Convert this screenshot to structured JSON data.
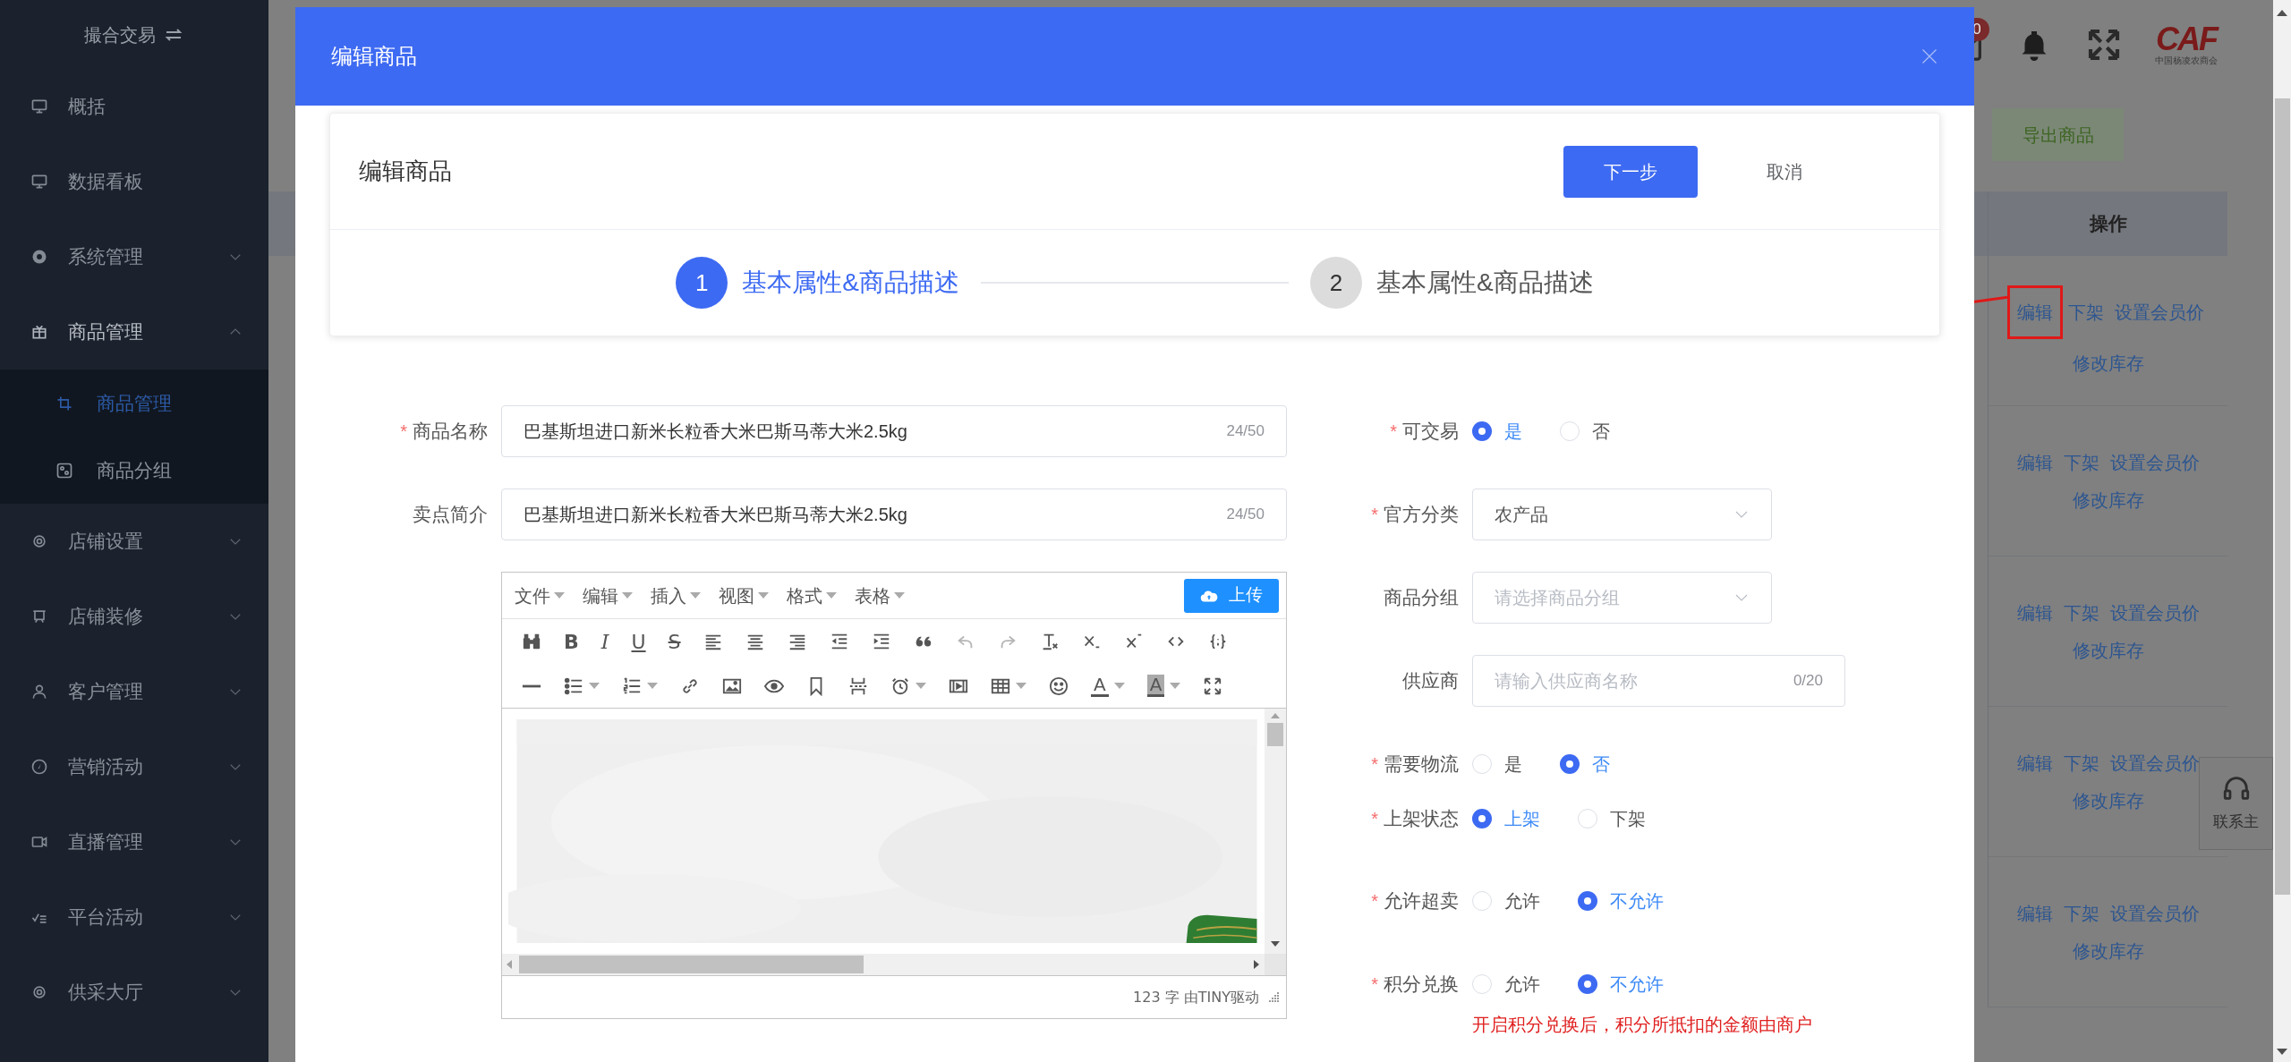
{
  "sidebar": {
    "title": "撮合交易",
    "items": [
      {
        "label": "概括",
        "kind": "link",
        "expanded": false,
        "selected": false
      },
      {
        "label": "数据看板",
        "kind": "link",
        "expanded": false,
        "selected": false
      },
      {
        "label": "系统管理",
        "kind": "menu",
        "expanded": false,
        "selected": false
      },
      {
        "label": "商品管理",
        "kind": "menu",
        "expanded": true,
        "selected": false,
        "children": [
          {
            "label": "商品管理",
            "selected": true
          },
          {
            "label": "商品分组",
            "selected": false
          }
        ]
      },
      {
        "label": "店铺设置",
        "kind": "menu",
        "expanded": false,
        "selected": false
      },
      {
        "label": "店铺装修",
        "kind": "menu",
        "expanded": false,
        "selected": false
      },
      {
        "label": "客户管理",
        "kind": "menu",
        "expanded": false,
        "selected": false
      },
      {
        "label": "营销活动",
        "kind": "menu",
        "expanded": false,
        "selected": false
      },
      {
        "label": "直播管理",
        "kind": "menu",
        "expanded": false,
        "selected": false
      },
      {
        "label": "平台活动",
        "kind": "menu",
        "expanded": false,
        "selected": false
      },
      {
        "label": "供采大厅",
        "kind": "menu",
        "expanded": false,
        "selected": false
      }
    ]
  },
  "header": {
    "mail_badge": "0",
    "logo": {
      "text": "CAF",
      "subtitle": "中国杨凌农商会"
    }
  },
  "page": {
    "export_button": "导出商品",
    "table": {
      "column": "操作",
      "rows": [
        {
          "actions": [
            "编辑",
            "下架",
            "设置会员价",
            "修改库存"
          ],
          "highlighted": true
        },
        {
          "actions": [
            "编辑",
            "下架",
            "设置会员价",
            "修改库存"
          ],
          "highlighted": false
        },
        {
          "actions": [
            "编辑",
            "下架",
            "设置会员价",
            "修改库存"
          ],
          "highlighted": false
        },
        {
          "actions": [
            "编辑",
            "下架",
            "设置会员价",
            "修改库存"
          ],
          "highlighted": false
        },
        {
          "actions": [
            "编辑",
            "下架",
            "设置会员价",
            "修改库存"
          ],
          "highlighted": false
        }
      ]
    }
  },
  "contact_button": "联系主",
  "modal": {
    "title": "编辑商品",
    "card_title": "编辑商品",
    "next_button": "下一步",
    "cancel_button": "取消",
    "steps": [
      {
        "number": "1",
        "label": "基本属性&商品描述",
        "selected": true
      },
      {
        "number": "2",
        "label": "基本属性&商品描述",
        "selected": false
      }
    ],
    "form_left": [
      {
        "label": "商品名称",
        "required_mark": "*",
        "value": "巴基斯坦进口新米长粒香大米巴斯马蒂大米2.5kg",
        "counter": "24/50"
      },
      {
        "label": "卖点简介",
        "value": "巴基斯坦进口新米长粒香大米巴斯马蒂大米2.5kg",
        "counter": "24/50"
      }
    ],
    "editor": {
      "menus": [
        "文件",
        "编辑",
        "插入",
        "视图",
        "格式",
        "表格"
      ],
      "upload": "上传",
      "status": "123 字 由TINY驱动",
      "toolbar": [
        [
          {
            "kind": "icon",
            "dropdown": false,
            "disabled": false
          },
          {
            "kind": "bold",
            "text": "B",
            "dropdown": false,
            "disabled": false
          },
          {
            "kind": "italic",
            "text": "I",
            "dropdown": false,
            "disabled": false
          },
          {
            "kind": "underline",
            "text": "U",
            "dropdown": false,
            "disabled": false
          },
          {
            "kind": "strike",
            "text": "S",
            "dropdown": false,
            "disabled": false
          },
          {
            "kind": "icon",
            "dropdown": false,
            "disabled": false
          },
          {
            "kind": "icon",
            "dropdown": false,
            "disabled": false
          },
          {
            "kind": "icon",
            "dropdown": false,
            "disabled": false
          },
          {
            "kind": "icon",
            "dropdown": false,
            "disabled": false
          },
          {
            "kind": "icon",
            "dropdown": false,
            "disabled": false
          },
          {
            "kind": "icon",
            "dropdown": false,
            "disabled": false
          },
          {
            "kind": "icon",
            "dropdown": false,
            "disabled": true
          },
          {
            "kind": "icon",
            "dropdown": false,
            "disabled": true
          },
          {
            "kind": "icon",
            "dropdown": false,
            "disabled": false
          },
          {
            "kind": "icon",
            "dropdown": false,
            "disabled": false
          },
          {
            "kind": "icon",
            "dropdown": false,
            "disabled": false
          },
          {
            "kind": "icon",
            "dropdown": false,
            "disabled": false
          },
          {
            "kind": "icon",
            "dropdown": false,
            "disabled": false
          }
        ],
        [
          {
            "kind": "icon",
            "dropdown": false,
            "disabled": false
          },
          {
            "kind": "icon",
            "dropdown": true,
            "disabled": false
          },
          {
            "kind": "icon",
            "dropdown": true,
            "disabled": false
          },
          {
            "kind": "icon",
            "dropdown": false,
            "disabled": false
          },
          {
            "kind": "icon",
            "dropdown": false,
            "disabled": false
          },
          {
            "kind": "icon",
            "dropdown": false,
            "disabled": false
          },
          {
            "kind": "icon",
            "dropdown": false,
            "disabled": false
          },
          {
            "kind": "icon",
            "dropdown": false,
            "disabled": false
          },
          {
            "kind": "icon",
            "dropdown": true,
            "disabled": false
          },
          {
            "kind": "icon",
            "dropdown": false,
            "disabled": false
          },
          {
            "kind": "icon",
            "dropdown": true,
            "disabled": false
          },
          {
            "kind": "icon",
            "dropdown": false,
            "disabled": false
          },
          {
            "kind": "textcolor",
            "text": "A",
            "dropdown": true,
            "disabled": false
          },
          {
            "kind": "backcolor",
            "text": "A",
            "dropdown": true,
            "disabled": false
          },
          {
            "kind": "icon",
            "dropdown": false,
            "disabled": false
          }
        ]
      ]
    },
    "form_right": [
      {
        "kind": "radio",
        "label": "可交易",
        "required_mark": "*",
        "options": [
          {
            "label": "是",
            "selected": true
          },
          {
            "label": "否",
            "selected": false
          }
        ]
      },
      {
        "kind": "select",
        "label": "官方分类",
        "required_mark": "*",
        "value": "农产品"
      },
      {
        "kind": "select",
        "label": "商品分组",
        "placeholder": "请选择商品分组"
      },
      {
        "kind": "text",
        "label": "供应商",
        "placeholder": "请输入供应商名称",
        "counter": "0/20"
      },
      {
        "kind": "radio",
        "label": "需要物流",
        "required_mark": "*",
        "options": [
          {
            "label": "是",
            "selected": false
          },
          {
            "label": "否",
            "selected": true
          }
        ]
      },
      {
        "kind": "radio",
        "label": "上架状态",
        "required_mark": "*",
        "options": [
          {
            "label": "上架",
            "selected": true
          },
          {
            "label": "下架",
            "selected": false
          }
        ]
      },
      {
        "kind": "radio",
        "label": "允许超卖",
        "required_mark": "*",
        "options": [
          {
            "label": "允许",
            "selected": false
          },
          {
            "label": "不允许",
            "selected": true
          }
        ]
      },
      {
        "kind": "radio",
        "label": "积分兑换",
        "required_mark": "*",
        "options": [
          {
            "label": "允许",
            "selected": false
          },
          {
            "label": "不允许",
            "selected": true
          }
        ]
      }
    ],
    "note": "开启积分兑换后，积分所抵扣的金额由商户"
  }
}
